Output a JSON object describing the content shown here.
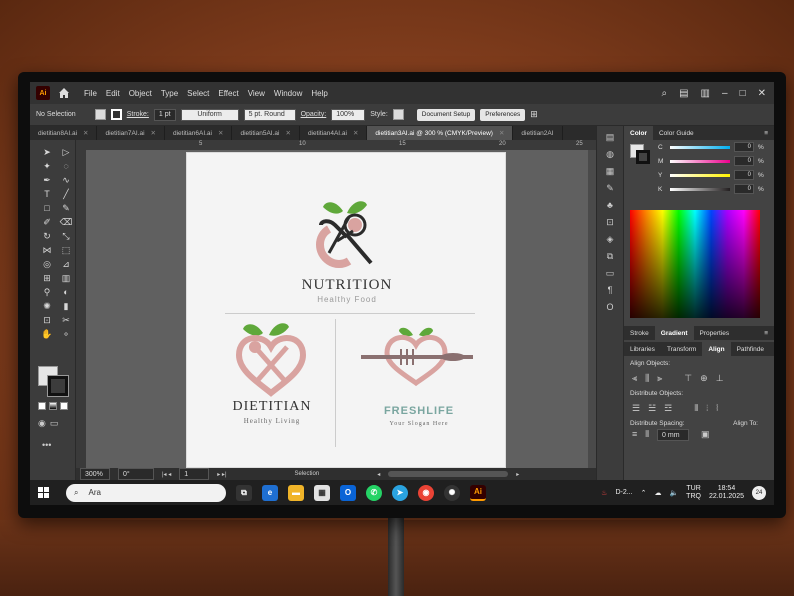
{
  "app": {
    "logo": "Ai"
  },
  "menu": {
    "items": [
      "File",
      "Edit",
      "Object",
      "Type",
      "Select",
      "Effect",
      "View",
      "Window",
      "Help"
    ]
  },
  "control": {
    "selection": "No Selection",
    "stroke_label": "Stroke:",
    "stroke_value": "1 pt",
    "profile": "Uniform",
    "brush": "5 pt. Round",
    "opacity_label": "Opacity:",
    "opacity_value": "100%",
    "style_label": "Style:",
    "document_setup": "Document Setup",
    "preferences": "Preferences"
  },
  "tabs": [
    {
      "label": "dietitian8AI.ai",
      "active": false
    },
    {
      "label": "dietitian7AI.ai",
      "active": false
    },
    {
      "label": "dietitian6AI.ai",
      "active": false
    },
    {
      "label": "dietitian5AI.ai",
      "active": false
    },
    {
      "label": "dietitian4AI.ai",
      "active": false
    },
    {
      "label": "dietitian3AI.ai @ 300 % (CMYK/Preview)",
      "active": true
    },
    {
      "label": "dietitian2AI",
      "active": false
    }
  ],
  "ruler": {
    "ticks": [
      "5",
      "10",
      "15",
      "20",
      "25"
    ]
  },
  "artwork": {
    "main_title": "NUTRITION",
    "main_subtitle": "Healthy Food",
    "left_title": "DIETITIAN",
    "left_subtitle": "Healthy Living",
    "right_title": "FRESHLIFE",
    "right_subtitle": "Your Slogan Here",
    "colors": {
      "leaf": "#5fa83a",
      "pink": "#d9a3a0",
      "dark": "#2b2b2b"
    }
  },
  "status": {
    "zoom": "300%",
    "rotation": "0°",
    "artboard": "1",
    "mode": "Selection"
  },
  "panels": {
    "color_tabs": [
      "Color",
      "Color Guide"
    ],
    "cmyk": [
      {
        "letter": "C",
        "value": "0",
        "color": "#00aeef"
      },
      {
        "letter": "M",
        "value": "0",
        "color": "#ec008c"
      },
      {
        "letter": "Y",
        "value": "0",
        "color": "#fff200"
      },
      {
        "letter": "K",
        "value": "0",
        "color": "#231f20"
      }
    ],
    "stroke_tabs": [
      "Stroke",
      "Gradient",
      "Properties"
    ],
    "align_tabs": [
      "Libraries",
      "Transform",
      "Align",
      "Pathfinde"
    ],
    "align_objects": "Align Objects:",
    "distribute_objects": "Distribute Objects:",
    "distribute_spacing": "Distribute Spacing:",
    "align_to": "Align To:",
    "spacing_value": "0 mm"
  },
  "taskbar": {
    "search_text": "Ara",
    "tray_item": "D-2...",
    "lang_top": "TUR",
    "lang_bottom": "TRQ",
    "time": "18:54",
    "date": "22.01.2025",
    "badge": "24"
  }
}
